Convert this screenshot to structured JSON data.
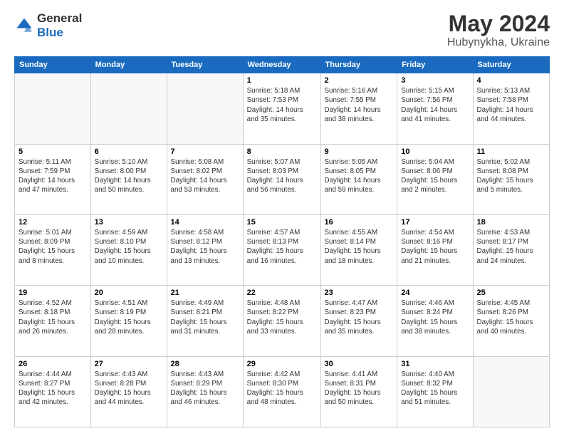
{
  "logo": {
    "general": "General",
    "blue": "Blue"
  },
  "title": "May 2024",
  "subtitle": "Hubynykha, Ukraine",
  "days_header": [
    "Sunday",
    "Monday",
    "Tuesday",
    "Wednesday",
    "Thursday",
    "Friday",
    "Saturday"
  ],
  "weeks": [
    [
      {
        "day": "",
        "info": ""
      },
      {
        "day": "",
        "info": ""
      },
      {
        "day": "",
        "info": ""
      },
      {
        "day": "1",
        "info": "Sunrise: 5:18 AM\nSunset: 7:53 PM\nDaylight: 14 hours\nand 35 minutes."
      },
      {
        "day": "2",
        "info": "Sunrise: 5:16 AM\nSunset: 7:55 PM\nDaylight: 14 hours\nand 38 minutes."
      },
      {
        "day": "3",
        "info": "Sunrise: 5:15 AM\nSunset: 7:56 PM\nDaylight: 14 hours\nand 41 minutes."
      },
      {
        "day": "4",
        "info": "Sunrise: 5:13 AM\nSunset: 7:58 PM\nDaylight: 14 hours\nand 44 minutes."
      }
    ],
    [
      {
        "day": "5",
        "info": "Sunrise: 5:11 AM\nSunset: 7:59 PM\nDaylight: 14 hours\nand 47 minutes."
      },
      {
        "day": "6",
        "info": "Sunrise: 5:10 AM\nSunset: 8:00 PM\nDaylight: 14 hours\nand 50 minutes."
      },
      {
        "day": "7",
        "info": "Sunrise: 5:08 AM\nSunset: 8:02 PM\nDaylight: 14 hours\nand 53 minutes."
      },
      {
        "day": "8",
        "info": "Sunrise: 5:07 AM\nSunset: 8:03 PM\nDaylight: 14 hours\nand 56 minutes."
      },
      {
        "day": "9",
        "info": "Sunrise: 5:05 AM\nSunset: 8:05 PM\nDaylight: 14 hours\nand 59 minutes."
      },
      {
        "day": "10",
        "info": "Sunrise: 5:04 AM\nSunset: 8:06 PM\nDaylight: 15 hours\nand 2 minutes."
      },
      {
        "day": "11",
        "info": "Sunrise: 5:02 AM\nSunset: 8:08 PM\nDaylight: 15 hours\nand 5 minutes."
      }
    ],
    [
      {
        "day": "12",
        "info": "Sunrise: 5:01 AM\nSunset: 8:09 PM\nDaylight: 15 hours\nand 8 minutes."
      },
      {
        "day": "13",
        "info": "Sunrise: 4:59 AM\nSunset: 8:10 PM\nDaylight: 15 hours\nand 10 minutes."
      },
      {
        "day": "14",
        "info": "Sunrise: 4:58 AM\nSunset: 8:12 PM\nDaylight: 15 hours\nand 13 minutes."
      },
      {
        "day": "15",
        "info": "Sunrise: 4:57 AM\nSunset: 8:13 PM\nDaylight: 15 hours\nand 16 minutes."
      },
      {
        "day": "16",
        "info": "Sunrise: 4:55 AM\nSunset: 8:14 PM\nDaylight: 15 hours\nand 18 minutes."
      },
      {
        "day": "17",
        "info": "Sunrise: 4:54 AM\nSunset: 8:16 PM\nDaylight: 15 hours\nand 21 minutes."
      },
      {
        "day": "18",
        "info": "Sunrise: 4:53 AM\nSunset: 8:17 PM\nDaylight: 15 hours\nand 24 minutes."
      }
    ],
    [
      {
        "day": "19",
        "info": "Sunrise: 4:52 AM\nSunset: 8:18 PM\nDaylight: 15 hours\nand 26 minutes."
      },
      {
        "day": "20",
        "info": "Sunrise: 4:51 AM\nSunset: 8:19 PM\nDaylight: 15 hours\nand 28 minutes."
      },
      {
        "day": "21",
        "info": "Sunrise: 4:49 AM\nSunset: 8:21 PM\nDaylight: 15 hours\nand 31 minutes."
      },
      {
        "day": "22",
        "info": "Sunrise: 4:48 AM\nSunset: 8:22 PM\nDaylight: 15 hours\nand 33 minutes."
      },
      {
        "day": "23",
        "info": "Sunrise: 4:47 AM\nSunset: 8:23 PM\nDaylight: 15 hours\nand 35 minutes."
      },
      {
        "day": "24",
        "info": "Sunrise: 4:46 AM\nSunset: 8:24 PM\nDaylight: 15 hours\nand 38 minutes."
      },
      {
        "day": "25",
        "info": "Sunrise: 4:45 AM\nSunset: 8:26 PM\nDaylight: 15 hours\nand 40 minutes."
      }
    ],
    [
      {
        "day": "26",
        "info": "Sunrise: 4:44 AM\nSunset: 8:27 PM\nDaylight: 15 hours\nand 42 minutes."
      },
      {
        "day": "27",
        "info": "Sunrise: 4:43 AM\nSunset: 8:28 PM\nDaylight: 15 hours\nand 44 minutes."
      },
      {
        "day": "28",
        "info": "Sunrise: 4:43 AM\nSunset: 8:29 PM\nDaylight: 15 hours\nand 46 minutes."
      },
      {
        "day": "29",
        "info": "Sunrise: 4:42 AM\nSunset: 8:30 PM\nDaylight: 15 hours\nand 48 minutes."
      },
      {
        "day": "30",
        "info": "Sunrise: 4:41 AM\nSunset: 8:31 PM\nDaylight: 15 hours\nand 50 minutes."
      },
      {
        "day": "31",
        "info": "Sunrise: 4:40 AM\nSunset: 8:32 PM\nDaylight: 15 hours\nand 51 minutes."
      },
      {
        "day": "",
        "info": ""
      }
    ]
  ]
}
